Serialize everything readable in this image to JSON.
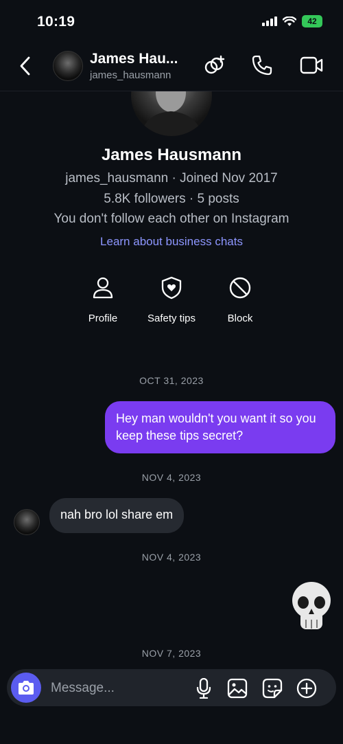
{
  "status_bar": {
    "time": "10:19",
    "battery": "42"
  },
  "header": {
    "name": "James Hau...",
    "username": "james_hausmann",
    "icons": [
      "back-icon",
      "add-participant-icon",
      "phone-icon",
      "video-icon"
    ]
  },
  "profile": {
    "name": "James Hausmann",
    "username_joined": "james_hausmann · Joined Nov 2017",
    "stats": "5.8K followers · 5 posts",
    "follow_status": "You don't follow each other on Instagram",
    "learn_link": "Learn about business chats",
    "actions": [
      {
        "label": "Profile",
        "icon": "person-icon"
      },
      {
        "label": "Safety tips",
        "icon": "shield-heart-icon"
      },
      {
        "label": "Block",
        "icon": "block-icon"
      }
    ]
  },
  "chat": {
    "date_1": "OCT 31, 2023",
    "message_out_1": "Hey man wouldn't you want it so you keep these tips secret?",
    "date_2": "NOV 4, 2023",
    "message_in_1": "nah bro lol share em",
    "date_3": "NOV 4, 2023",
    "message_out_2_emoji": "skull-emoji",
    "date_4": "NOV 7, 2023"
  },
  "composer": {
    "placeholder": "Message...",
    "icons": [
      "camera-icon",
      "microphone-icon",
      "gallery-icon",
      "sticker-icon",
      "plus-icon"
    ]
  },
  "colors": {
    "background": "#0c0f14",
    "outgoing_bubble": "#7a3cf0",
    "incoming_bubble": "#262a31",
    "link": "#8d96ff",
    "camera_button": "#5b5cf0",
    "battery": "#34c759"
  }
}
